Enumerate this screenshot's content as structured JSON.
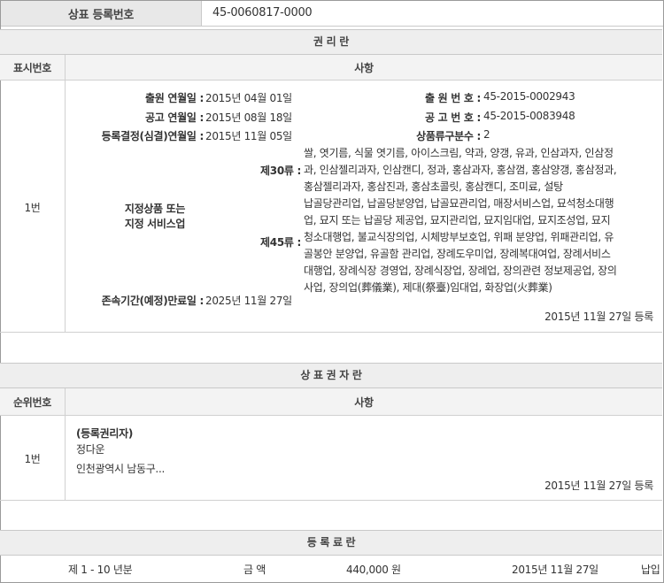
{
  "reg_label": "상표 등록번호",
  "reg_number": "45-0060817-0000",
  "rights_title": "권 리 란",
  "rights_header": {
    "col1": "표시번호",
    "col2": "사항"
  },
  "rights_row": {
    "num": "1번",
    "filing_date_label": "출원 연월일 :",
    "filing_date": "2015년 04월 01일",
    "pub_date_label": "공고 연월일 :",
    "pub_date": "2015년 08월 18일",
    "reg_decision_label": "등록결정(심결)연월일 :",
    "reg_decision": "2015년 11월 05일",
    "app_no_label": "출 원 번 호 :",
    "app_no": "45-2015-0002943",
    "pub_no_label": "공 고 번 호 :",
    "pub_no": "45-2015-0083948",
    "class_count_label": "상품류구분수 :",
    "class_count": "2",
    "goods_label_1": "지정상품 또는",
    "goods_label_2": "지정 서비스업",
    "class30_label": "제30류 :",
    "class30_lines": [
      "쌀, 엿기름, 식물 엿기름, 아이스크림, 약과, 양갱, 유과, 인삼과자, 인삼정",
      "과, 인삼젤리과자, 인삼캔디, 정과, 홍삼과자, 홍삼껌, 홍삼양갱, 홍삼정과,",
      "홍삼젤리과자, 홍삼진과, 홍삼초콜릿, 홍삼캔디, 조미료, 설탕"
    ],
    "class45_label": "제45류 :",
    "class45_lines": [
      "납골당관리업, 납골당분양업, 납골묘관리업, 매장서비스업, 묘석청소대행",
      "업, 묘지 또는 납골당 제공업, 묘지관리업, 묘지임대업, 묘지조성업, 묘지",
      "청소대행업, 불교식장의업, 시체방부보호업, 위패 분양업, 위패관리업, 유",
      "골봉안 분양업, 유골함 관리업, 장례도우미업, 장례복대여업, 장례서비스",
      "대행업, 장례식장 경영업, 장례식장업, 장례업, 장의관련 정보제공업, 장의",
      "사업, 장의업(葬儀業), 제대(祭臺)임대업, 화장업(火葬業)"
    ],
    "expiry_label": "존속기간(예정)만료일 :",
    "expiry": "2025년 11월 27일",
    "registered": "2015년 11월 27일 등록"
  },
  "holder_title": "상 표 권 자 란",
  "holder_header": {
    "col1": "순위번호",
    "col2": "사항"
  },
  "holder_row": {
    "num": "1번",
    "type": "(등록권리자)",
    "name": "정다운",
    "address": "인천광역시 남동구...",
    "registered": "2015년 11월 27일 등록"
  },
  "fee_title": "등 록 료 란",
  "fee_row": {
    "period": "제 1 - 10 년분",
    "amount_label": "금 액",
    "amount": "440,000 원",
    "date": "2015년 11월 27일",
    "status": "납입"
  }
}
